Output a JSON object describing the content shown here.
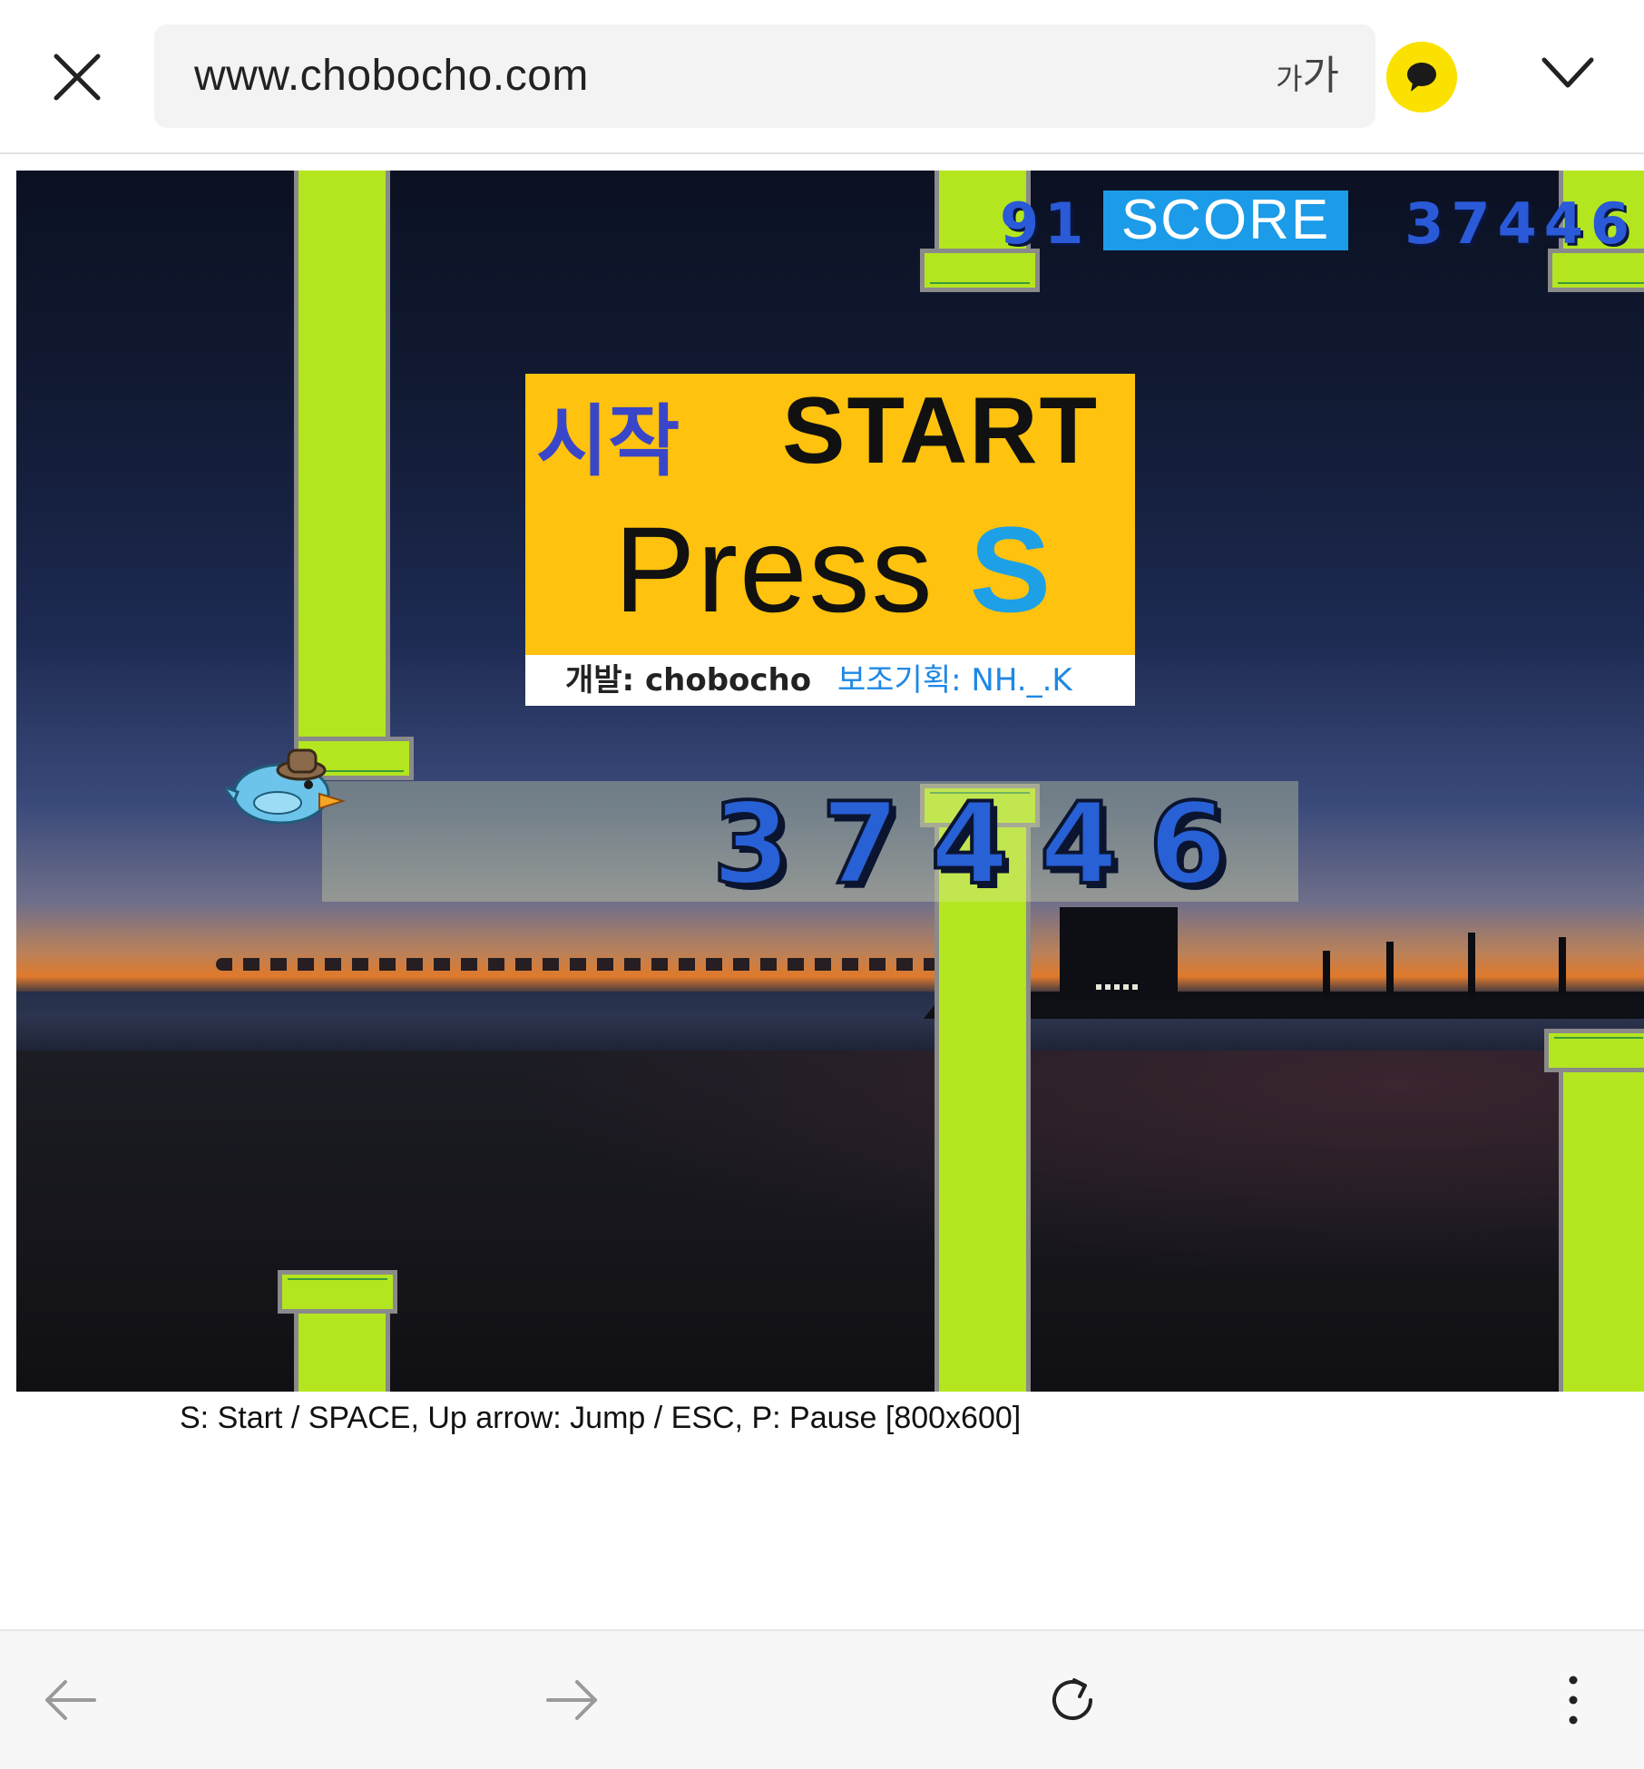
{
  "browser": {
    "url": "www.chobocho.com",
    "text_size_small": "가",
    "text_size_large": "가",
    "icons": {
      "close": "close-icon",
      "talk": "chat-bubble-icon",
      "menu": "chevron-down-icon",
      "back": "arrow-left-icon",
      "forward": "arrow-right-icon",
      "reload": "reload-icon",
      "more": "more-vertical-icon"
    },
    "accent_color": "#fae100"
  },
  "game": {
    "hud": {
      "left_value": "91",
      "score_label": "SCORE",
      "right_value": "37446"
    },
    "start_panel": {
      "title_ko": "시작",
      "title_en": "START",
      "press_word": "Press",
      "press_key": "S",
      "credit_dev": "개발: chobocho",
      "credit_plan": "보조기획: NH._.K"
    },
    "best_score": "37446",
    "colors": {
      "pipe": "#b4e61f",
      "panel": "#ffc20e",
      "score_badge": "#1b9be8",
      "digits": "#2860d6"
    }
  },
  "instructions": "S: Start / SPACE, Up arrow: Jump / ESC, P: Pause [800x600]"
}
